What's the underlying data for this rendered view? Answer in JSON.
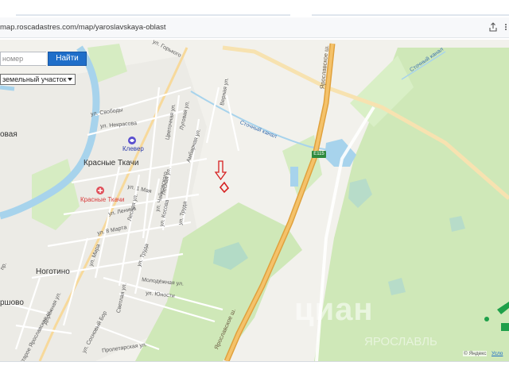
{
  "browser": {
    "url": "map.roscadastres.com/map/yaroslavskaya-oblast"
  },
  "search": {
    "placeholder": "номер",
    "button_label": "Найти",
    "type_selected": "земельный участок"
  },
  "map": {
    "towns": {
      "krasnye_tkachi": "Красные Ткачи",
      "nogotino": "Ноготино",
      "left_village": "овая",
      "bottom_village": "ршово"
    },
    "pois": {
      "klever": "Клевер",
      "krasnye_tkachi_poi": "Красные Ткачи"
    },
    "streets": {
      "gorkogo": "ул. Горького",
      "svobody": "ул. Свободы",
      "nekrasova": "ул. Некрасова",
      "tsvetochnaya": "Цветочная ул.",
      "lugovaya": "Луговая ул.",
      "vernaya": "Верная ул.",
      "ambarnaya": "Амбарная ул.",
      "lesnaya": "Лесная ул.",
      "pervoe_maya": "ул. 1 Мая",
      "chaykovskogo": "ул. Чайковского",
      "lenina": "ул. Ленина",
      "lesnaya2": "Лесная ул.",
      "kosova": "ул. Косова",
      "truda": "ул. Труда",
      "vos_marta": "ул. 8 Марта",
      "mira": "ул. Мира",
      "truda2": "ул. Труда",
      "molodezhnaya": "Молодёжная ул.",
      "yunosti": "ул. Юности",
      "svetlaya": "Светлая ул.",
      "dorozhnaya": "Дорожная ул.",
      "staroe_yaroslavskoe": "Старое Ярославское ш.",
      "sosnovy_bor": "ул. Сосновый Бор",
      "proletarskaya": "Пролетарская ул.",
      "proezd": "пр."
    },
    "canals": {
      "canal_1": "Сточный канал",
      "canal_2": "Сточный канал"
    },
    "highways": {
      "yaroslavskoe_top": "Ярославское ш.",
      "yaroslavskoe_bottom": "Ярославское ш.",
      "route_badge": "E115"
    },
    "watermark": "циан",
    "watermark_sub": "ЯРОСЛАВЛЬ",
    "copyright": "© Яндекс",
    "terms": "Усло"
  },
  "colors": {
    "search_button": "#1f6ec9",
    "forest": "#cfe8b8",
    "river": "#a7d3ec",
    "highway": "#f0b757",
    "marker": "#d62020"
  }
}
